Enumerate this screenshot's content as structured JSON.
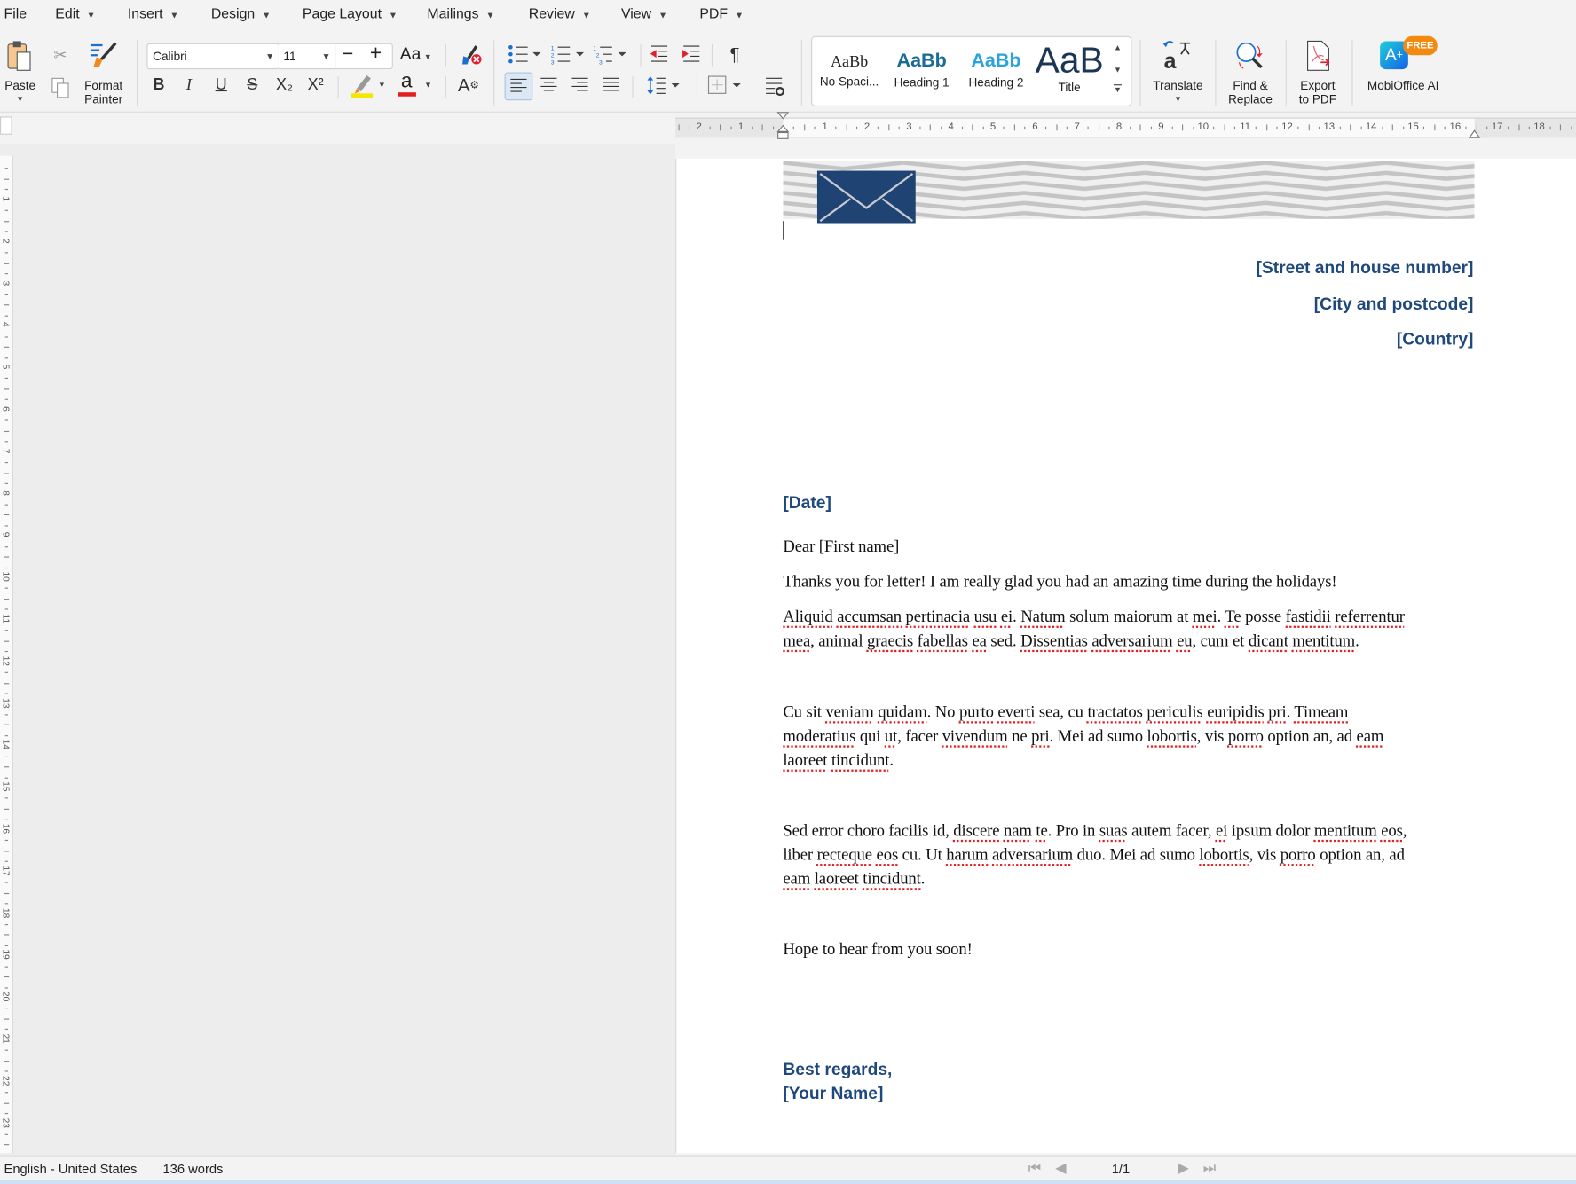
{
  "menu": [
    {
      "label": "File"
    },
    {
      "label": "Edit"
    },
    {
      "label": "Insert"
    },
    {
      "label": "Design"
    },
    {
      "label": "Page Layout"
    },
    {
      "label": "Mailings"
    },
    {
      "label": "Review"
    },
    {
      "label": "View"
    },
    {
      "label": "PDF"
    }
  ],
  "ribbon": {
    "paste": "Paste",
    "format_painter_1": "Format",
    "format_painter_2": "Painter",
    "font": "Calibri",
    "size": "11",
    "case": "Aa",
    "styles": [
      {
        "preview": "AaBb",
        "label": "No Spaci..."
      },
      {
        "preview": "AaBb",
        "label": "Heading 1"
      },
      {
        "preview": "AaBb",
        "label": "Heading 2"
      },
      {
        "preview": "AaB",
        "label": "Title"
      }
    ],
    "translate": "Translate",
    "find_1": "Find &",
    "find_2": "Replace",
    "export_1": "Export",
    "export_2": "to PDF",
    "ai": "MobiOffice AI",
    "ai_badge": "FREE",
    "bold": "B",
    "italic": "I",
    "underline": "U",
    "strike": "S",
    "sub": "X₂",
    "sup": "X²",
    "font_color": "a",
    "pilcrow": "¶"
  },
  "colors": {
    "accent": "#1f497d",
    "highlight": "#f5e600",
    "font_color": "#e02020",
    "spell": "#e02020"
  },
  "ruler": {
    "h_labels": [
      "2",
      "1",
      "1",
      "2",
      "3",
      "4",
      "5",
      "6",
      "7",
      "8",
      "9",
      "10",
      "11",
      "12",
      "13",
      "14",
      "15",
      "16",
      "17",
      "18"
    ],
    "v_labels": [
      "1",
      "2",
      "3",
      "4",
      "5",
      "6",
      "7",
      "8",
      "9",
      "10",
      "11",
      "12",
      "13",
      "14",
      "15",
      "16",
      "17",
      "18",
      "19",
      "20",
      "21",
      "22",
      "23"
    ]
  },
  "document": {
    "address": [
      "[Street and house number]",
      "[City and postcode]",
      "[Country]"
    ],
    "date": "[Date]",
    "greeting": "Dear [First name]",
    "intro": "Thanks you for letter! I am really glad you had an amazing time during the holidays!",
    "paragraphs": [
      [
        [
          [
            "Aliquid",
            1
          ],
          [
            " ",
            0
          ],
          [
            "accumsan",
            1
          ],
          [
            " ",
            0
          ],
          [
            "pertinacia",
            1
          ],
          [
            " ",
            0
          ],
          [
            "usu",
            1
          ],
          [
            " ",
            0
          ],
          [
            "ei",
            1
          ],
          [
            ". ",
            0
          ],
          [
            "Natum",
            1
          ],
          [
            " solum maiorum at ",
            0
          ],
          [
            "mei",
            1
          ],
          [
            ". ",
            0
          ],
          [
            "Te",
            1
          ],
          [
            " posse ",
            0
          ],
          [
            "fastidii",
            1
          ],
          [
            " ",
            0
          ],
          [
            "referrentur",
            1
          ]
        ],
        [
          [
            "mea",
            1
          ],
          [
            ", animal ",
            0
          ],
          [
            "graecis",
            1
          ],
          [
            " ",
            0
          ],
          [
            "fabellas",
            1
          ],
          [
            " ",
            0
          ],
          [
            "ea",
            1
          ],
          [
            " sed. ",
            0
          ],
          [
            "Dissentias",
            1
          ],
          [
            " ",
            0
          ],
          [
            "adversarium",
            1
          ],
          [
            " ",
            0
          ],
          [
            "eu",
            1
          ],
          [
            ", cum et ",
            0
          ],
          [
            "dicant",
            1
          ],
          [
            " ",
            0
          ],
          [
            "mentitum",
            1
          ],
          [
            ".",
            0
          ]
        ]
      ],
      [
        [
          [
            "Cu sit ",
            0
          ],
          [
            "veniam",
            1
          ],
          [
            " ",
            0
          ],
          [
            "quidam",
            1
          ],
          [
            ". No ",
            0
          ],
          [
            "purto",
            1
          ],
          [
            " ",
            0
          ],
          [
            "everti",
            1
          ],
          [
            " sea, cu ",
            0
          ],
          [
            "tractatos",
            1
          ],
          [
            " ",
            0
          ],
          [
            "periculis",
            1
          ],
          [
            " ",
            0
          ],
          [
            "euripidis",
            1
          ],
          [
            " ",
            0
          ],
          [
            "pri",
            1
          ],
          [
            ". ",
            0
          ],
          [
            "Timeam",
            1
          ]
        ],
        [
          [
            "moderatius",
            1
          ],
          [
            " qui ",
            0
          ],
          [
            "ut",
            1
          ],
          [
            ", facer ",
            0
          ],
          [
            "vivendum",
            1
          ],
          [
            " ne ",
            0
          ],
          [
            "pri",
            1
          ],
          [
            ". Mei ad sumo ",
            0
          ],
          [
            "lobortis",
            1
          ],
          [
            ", vis ",
            0
          ],
          [
            "porro",
            1
          ],
          [
            " option an, ad ",
            0
          ],
          [
            "eam",
            1
          ]
        ],
        [
          [
            "laoreet",
            1
          ],
          [
            " ",
            0
          ],
          [
            "tincidunt",
            1
          ],
          [
            ".",
            0
          ]
        ]
      ],
      [
        [
          [
            "Sed error choro facilis id, ",
            0
          ],
          [
            "discere",
            1
          ],
          [
            " ",
            0
          ],
          [
            "nam",
            1
          ],
          [
            " ",
            0
          ],
          [
            "te",
            1
          ],
          [
            ". Pro in ",
            0
          ],
          [
            "suas",
            1
          ],
          [
            " autem facer, ",
            0
          ],
          [
            "ei",
            1
          ],
          [
            " ipsum dolor ",
            0
          ],
          [
            "mentitum",
            1
          ],
          [
            " ",
            0
          ],
          [
            "eos",
            1
          ],
          [
            ",",
            0
          ]
        ],
        [
          [
            "liber ",
            0
          ],
          [
            "recteque",
            1
          ],
          [
            " ",
            0
          ],
          [
            "eos",
            1
          ],
          [
            " cu. Ut ",
            0
          ],
          [
            "harum",
            1
          ],
          [
            " ",
            0
          ],
          [
            "adversarium",
            1
          ],
          [
            " duo. Mei ad sumo ",
            0
          ],
          [
            "lobortis",
            1
          ],
          [
            ", vis ",
            0
          ],
          [
            "porro",
            1
          ],
          [
            " option an, ad",
            0
          ]
        ],
        [
          [
            "eam",
            1
          ],
          [
            " ",
            0
          ],
          [
            "laoreet",
            1
          ],
          [
            " ",
            0
          ],
          [
            "tincidunt",
            1
          ],
          [
            ".",
            0
          ]
        ]
      ]
    ],
    "closing_line": "Hope to hear from you soon!",
    "regards": "Best regards,",
    "name": "[Your Name]"
  },
  "status": {
    "language": "English - United States",
    "words": "136 words",
    "page": "1/1"
  }
}
